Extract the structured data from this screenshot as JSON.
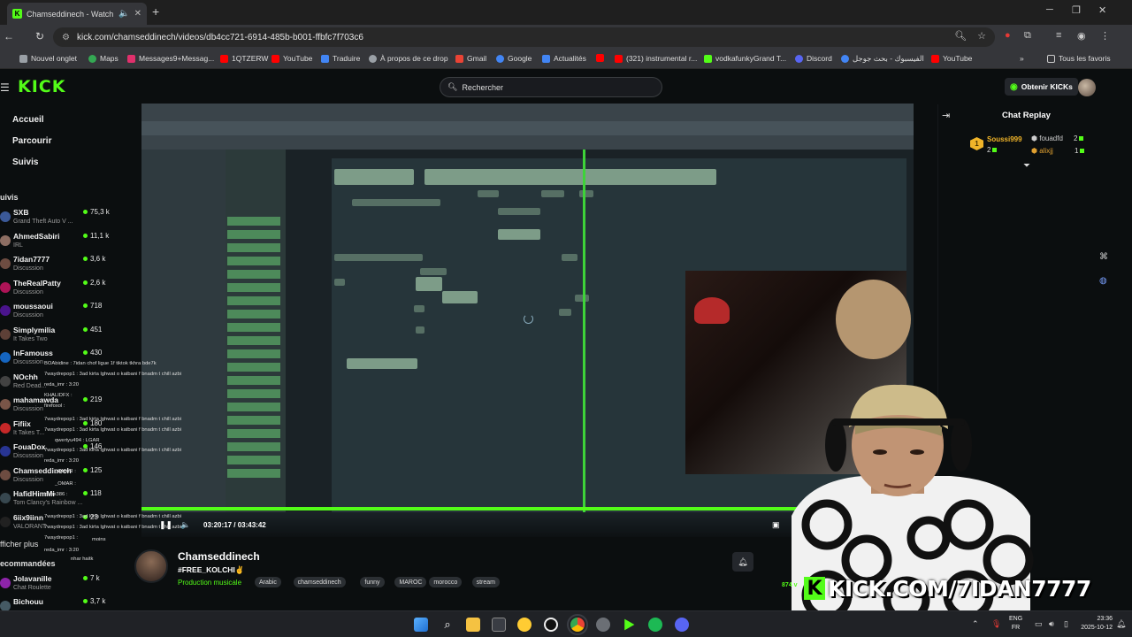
{
  "browser": {
    "tab_title": "Chamseddinech - Watch th",
    "tab_favicon": "K",
    "url": "kick.com/chamseddinech/videos/db4cc721-6914-485b-b001-ffbfc7f703c6",
    "new_tab": "+",
    "bookmarks": [
      {
        "label": "Nouvel onglet",
        "color": "#9aa0a6"
      },
      {
        "label": "Maps",
        "color": "#34a853"
      },
      {
        "label": "Messages9+Messag...",
        "color": "#e1306c"
      },
      {
        "label": "1QTZERW",
        "color": "#ff0000"
      },
      {
        "label": "YouTube",
        "color": "#ff0000"
      },
      {
        "label": "Traduire",
        "color": "#4285f4"
      },
      {
        "label": "À propos de ce drop",
        "color": "#9aa0a6"
      },
      {
        "label": "Gmail",
        "color": "#ea4335"
      },
      {
        "label": "Google",
        "color": "#4285f4"
      },
      {
        "label": "Actualités",
        "color": "#4285f4"
      },
      {
        "label": "(321) instrumental r...",
        "color": "#ff0000"
      },
      {
        "label": "vodkafunkyGrand T...",
        "color": "#53fc18"
      },
      {
        "label": "Discord",
        "color": "#5865f2"
      },
      {
        "label": "الفيسبوك - بحث جوجل",
        "color": "#4285f4"
      },
      {
        "label": "YouTube",
        "color": "#ff0000"
      }
    ],
    "all_bookmarks": "Tous les favoris"
  },
  "kick": {
    "logo": "KICK",
    "search_placeholder": "Rechercher",
    "get_kicks": "Obtenir KICKs",
    "nav": [
      "Accueil",
      "Parcourir",
      "Suivis"
    ],
    "followed_header": "uivis",
    "show_more": "fficher plus",
    "recommended_header": "ecommandées",
    "channels": [
      {
        "name": "SXB",
        "category": "Grand Theft Auto V ...",
        "viewers": "75,3 k",
        "color": "#3b5998"
      },
      {
        "name": "AhmedSabiri",
        "category": "IRL",
        "viewers": "11,1 k",
        "color": "#8d6e63"
      },
      {
        "name": "7idan7777",
        "category": "Discussion",
        "viewers": "3,6 k",
        "color": "#6d4c41"
      },
      {
        "name": "TheRealPatty",
        "category": "Discussion",
        "viewers": "2,6 k",
        "color": "#ad1457"
      },
      {
        "name": "moussaoui",
        "category": "Discussion",
        "viewers": "718",
        "color": "#4a148c"
      },
      {
        "name": "Simplymilia",
        "category": "It Takes Two",
        "viewers": "451",
        "color": "#5d4037"
      },
      {
        "name": "InFamouss",
        "category": "Discussion",
        "viewers": "430",
        "color": "#1565c0"
      },
      {
        "name": "NOchh",
        "category": "Red Dead...",
        "viewers": "",
        "color": "#424242"
      },
      {
        "name": "mahamawda",
        "category": "Discussion",
        "viewers": "219",
        "color": "#795548"
      },
      {
        "name": "Fifiix",
        "category": "It Takes T...",
        "viewers": "180",
        "color": "#c62828"
      },
      {
        "name": "FouaDox",
        "category": "Discussion",
        "viewers": "146",
        "color": "#283593"
      },
      {
        "name": "Chamseddinech",
        "category": "Discussion",
        "viewers": "125",
        "color": "#6d4c41"
      },
      {
        "name": "HafidHimMi",
        "category": "Tom Clancy's Rainbow ...",
        "viewers": "118",
        "color": "#37474f"
      },
      {
        "name": "6iix9iinn",
        "category": "VALORANT",
        "viewers": "23",
        "color": "#212121"
      }
    ],
    "recommended": [
      {
        "name": "Jolavanille",
        "category": "Chat Roulette",
        "viewers": "7 k",
        "color": "#8e24aa"
      },
      {
        "name": "Bichouu",
        "category": "",
        "viewers": "3,7 k",
        "color": "#455a64"
      }
    ],
    "overlay_chat": [
      "BOAbidine : 7idan chof ligue 1f tiktok tkhra bde7k",
      "7waydrepop1 : 3ad kirta lghwat o katbani f bnadm t chill azbi",
      "reda_imr : 3:20",
      "KHALIDFX :",
      "firefoxol :",
      "7waydrepop1 : 3ad kirta lghwat o katbani f bnadm t chill azbi",
      "7waydrepop1 : 3ad kirta lghwat o katbani f bnadm t chill azbi",
      "qwertyu494 : LGAR",
      "7waydrepop1 : 3ad kirta lghwat o katbani f bnadm t chill azbi",
      "reda_imr : 3:20",
      "_OMAR :",
      "_OMAR :",
      "zinex386 :",
      "7waydrepop1 : 3ad kirta lghwat o katbani f bnadm t chill azbi",
      "7waydrepop1 : 3ad kirta lghwat o katbani f bnadm t chill azbi",
      "7waydrepop1 :",
      "reda_imr : 3:20",
      "moins",
      "nhar haitk"
    ],
    "video": {
      "time": "03:20:17 / 03:43:42",
      "progress": 0.913
    },
    "stream": {
      "streamer": "Chamseddinech",
      "title": "#FREE_KOLCHI✌️",
      "category": "Production musicale",
      "tags": [
        "Arabic",
        "chamseddinech",
        "funny",
        "MAROC",
        "morocco",
        "stream"
      ]
    },
    "chat": {
      "title": "Chat Replay",
      "leaders": [
        {
          "rank": "1",
          "name": "Soussi999",
          "count": "2"
        },
        {
          "name": "fouadfd",
          "count": "2"
        },
        {
          "name": "alixjj",
          "count": "1"
        }
      ]
    },
    "overlay": {
      "banner": "KICK.COM/7IDAN7777",
      "viewers": "874 v"
    }
  },
  "taskbar": {
    "lang1": "ENG",
    "lang2": "FR",
    "time": "23:36",
    "date": "2025-10-12"
  }
}
